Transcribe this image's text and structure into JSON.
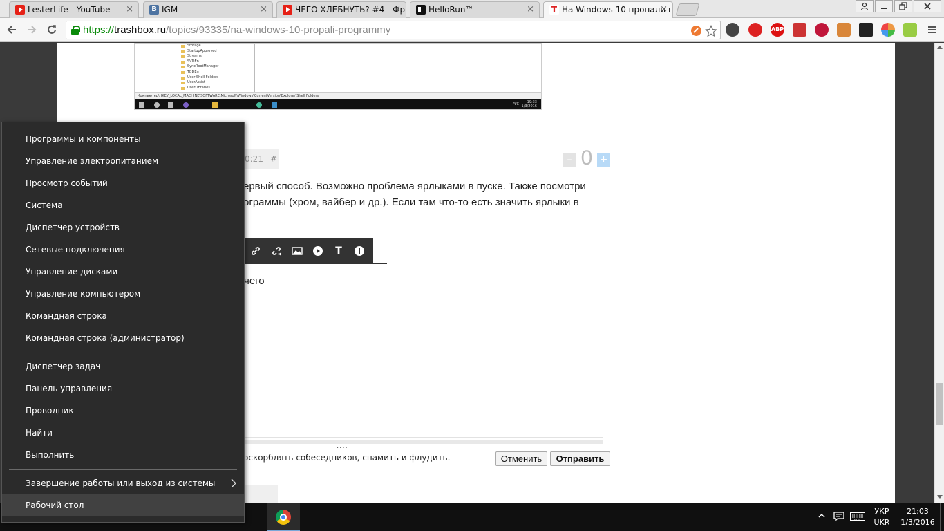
{
  "browser": {
    "tabs": [
      {
        "title": "LesterLife - YouTube",
        "favicon": "youtube-icon"
      },
      {
        "title": "IGM",
        "favicon": "vk-icon"
      },
      {
        "title": "ЧЕГО ХЛЕБНУТЬ? #4 - Фр",
        "favicon": "youtube-icon"
      },
      {
        "title": "HelloRun™",
        "favicon": "hellorun-icon"
      },
      {
        "title": "На Windows 10 пропали п",
        "favicon": "trashbox-icon",
        "active": true
      }
    ],
    "vk_glyph": "B",
    "tb_glyph": "T",
    "tab_close": "×",
    "url": {
      "scheme": "https://",
      "host": "trashbox.ru",
      "path": "/topics/93335/na-windows-10-propali-programmy"
    },
    "extensions": {
      "abp_label": "ABP"
    }
  },
  "embedded_screenshot": {
    "tree_items": [
      "Storage",
      "StartupApproved",
      "Streams",
      "SVDEn",
      "SyncRootManager",
      "TBDEn",
      "User Shell Folders",
      "UserAssist",
      "UserLibraries",
      "VirtualDesk"
    ],
    "path": "Компьютер\\HKEY_LOCAL_MACHINE\\SOFTWARE\\Microsoft\\Windows\\CurrentVersion\\Explorer\\Shell Folders",
    "lang": "РУС",
    "time": "19:33",
    "date": "1/3/2016"
  },
  "comment": {
    "time_fragment": "0:21",
    "hash": "#",
    "vote_minus": "–",
    "vote_count": "0",
    "vote_plus": "+",
    "text_line1": "ервый способ. Возможно проблема ярлыками в пуске. Также посмотри",
    "text_line2": "ограммы (хром, вайбер и др.). Если там что-то есть значить ярлыки в"
  },
  "editor": {
    "content": "чего",
    "resize_handle": "....",
    "rules_text": "оскорблять собеседников, спамить и флудить.",
    "cancel_label": "Отменить",
    "send_label": "Отправить",
    "text_tool_glyph": "T",
    "info_tool_glyph": "i"
  },
  "winx_menu": {
    "group1": [
      "Программы и компоненты",
      "Управление электропитанием",
      "Просмотр событий",
      "Система",
      "Диспетчер устройств",
      "Сетевые подключения",
      "Управление дисками",
      "Управление компьютером",
      "Командная строка",
      "Командная строка (администратор)"
    ],
    "group2": [
      "Диспетчер задач",
      "Панель управления",
      "Проводник",
      "Найти",
      "Выполнить"
    ],
    "shutdown": "Завершение работы или выход из системы",
    "desktop": "Рабочий стол"
  },
  "taskbar": {
    "lang_top": "УКР",
    "lang_bottom": "UKR",
    "time": "21:03",
    "date": "1/3/2016"
  }
}
